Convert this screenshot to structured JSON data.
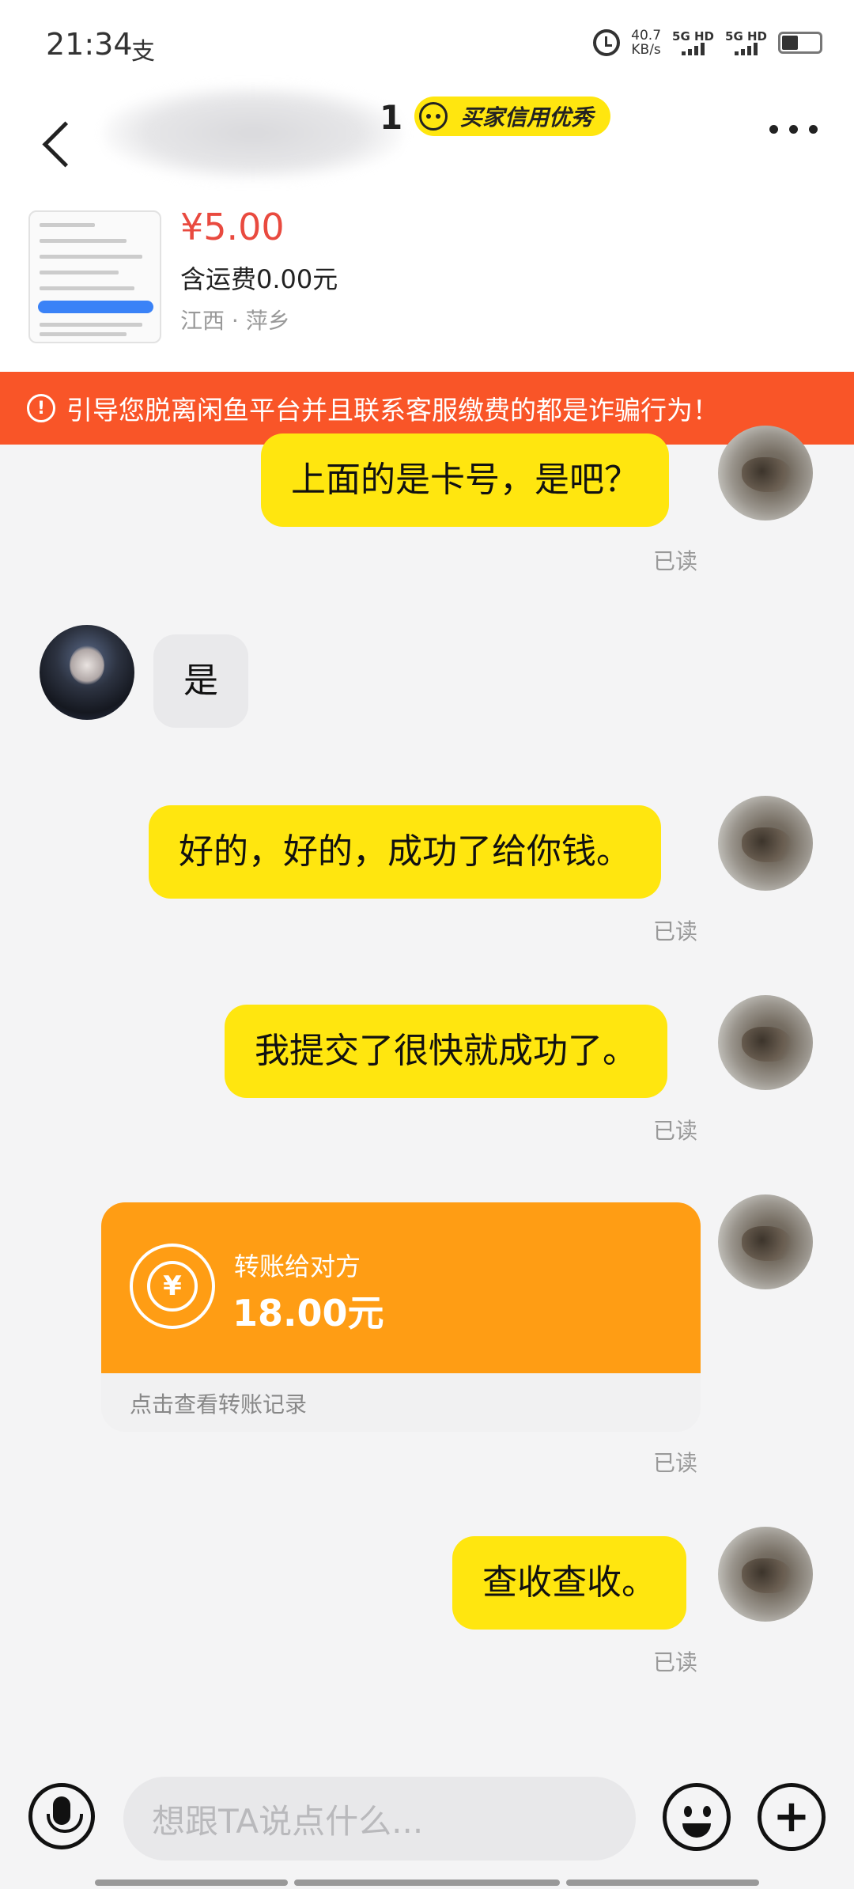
{
  "status_bar": {
    "time": "21:34",
    "app_icon": "支",
    "net_speed_value": "40.7",
    "net_speed_unit": "KB/s",
    "sim1": "5G HD",
    "sim2": "5G HD"
  },
  "header": {
    "name_visible_tail": "1",
    "credit_badge": "买家信用优秀"
  },
  "product": {
    "price": "¥5.00",
    "shipping": "含运费0.00元",
    "location": "江西 · 萍乡"
  },
  "warning": {
    "text": "引导您脱离闲鱼平台并且联系客服缴费的都是诈骗行为！"
  },
  "messages": [
    {
      "from": "me",
      "text": "上面的是卡号，是吧？",
      "status": "已读"
    },
    {
      "from": "other",
      "text": "是"
    },
    {
      "from": "me",
      "text": "好的，好的，成功了给你钱。",
      "status": "已读"
    },
    {
      "from": "me",
      "text": "我提交了很快就成功了。",
      "status": "已读"
    },
    {
      "from": "me",
      "type": "transfer",
      "title": "转账给对方",
      "amount": "18.00元",
      "footer": "点击查看转账记录",
      "status": "已读"
    },
    {
      "from": "me",
      "text": "查收查收。",
      "status": "已读"
    }
  ],
  "input": {
    "placeholder": "想跟TA说点什么..."
  },
  "colors": {
    "accent_yellow": "#ffe60f",
    "warning_red": "#f95528",
    "transfer_orange": "#ff9d14",
    "price_red": "#e94a3f"
  },
  "icons": [
    "back-icon",
    "more-icon",
    "warning-icon",
    "yen-transfer-icon",
    "mic-icon",
    "emoji-icon",
    "plus-icon"
  ]
}
